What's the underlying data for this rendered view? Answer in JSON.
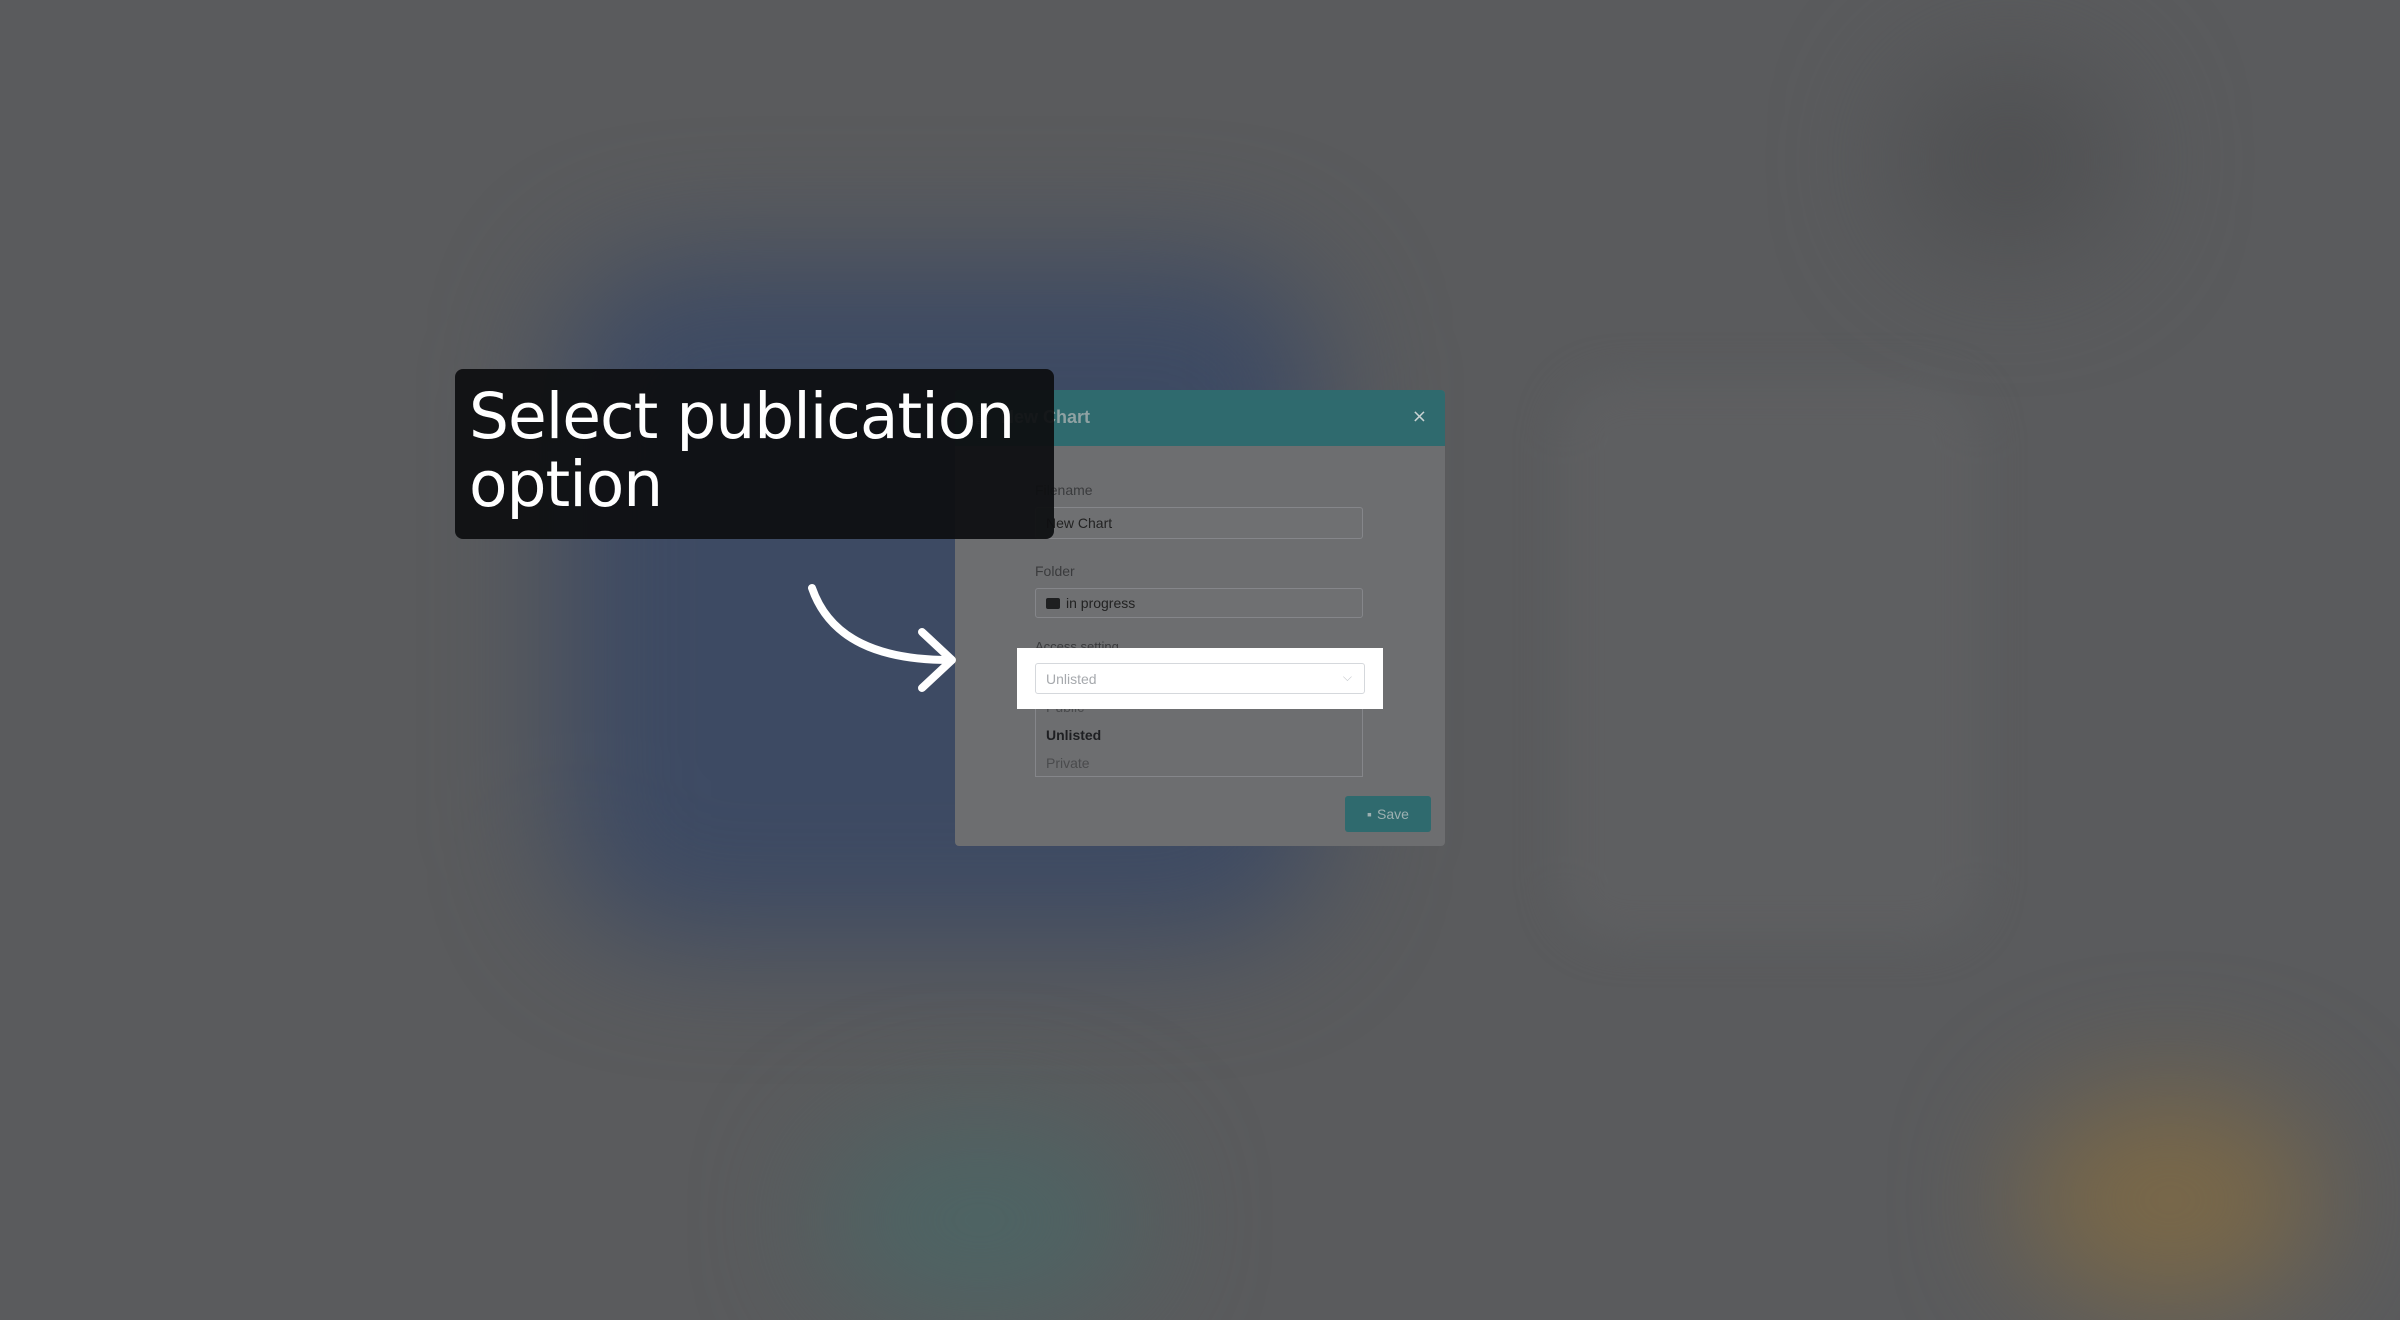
{
  "dialog": {
    "title": "New Chart",
    "close_label": "×",
    "filename_label": "Filename",
    "filename_value": "New Chart",
    "folder_label": "Folder",
    "folder_value": "in progress",
    "access_label": "Access setting",
    "access_selected": "Unlisted",
    "access_options": [
      "Public",
      "Unlisted",
      "Private"
    ],
    "save_label": "Save"
  },
  "tutorial": {
    "callout_text": "Select publication option"
  },
  "colors": {
    "accent": "#2f6a6e",
    "overlay": "#5a5b5d",
    "callout_bg": "#0e0f11"
  }
}
